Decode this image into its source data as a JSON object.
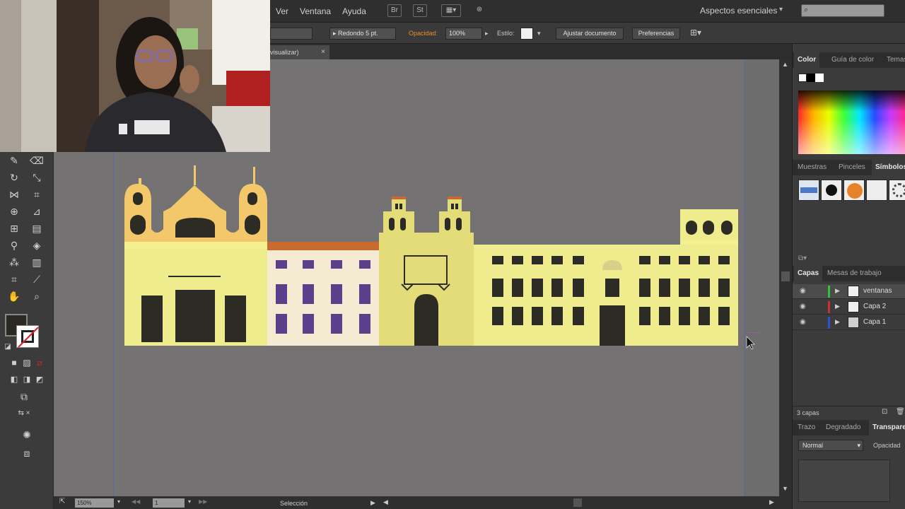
{
  "menu": {
    "items": [
      "Ver",
      "Ventana",
      "Ayuda"
    ],
    "workspace": "Aspectos esenciales"
  },
  "control_bar": {
    "brush": "Redondo 5 pt.",
    "opacity_label": "Opacidad:",
    "opacity_value": "100%",
    "style_label": "Estilo:",
    "doc_setup_button": "Ajustar documento",
    "prefs_button": "Preferencias"
  },
  "document": {
    "tab_label": "visualizar)",
    "close": "×"
  },
  "status": {
    "zoom": "150%",
    "page": "1",
    "tool": "Selección"
  },
  "panels": {
    "color_tabs": [
      "Color",
      "Guía de color",
      "Temas"
    ],
    "swatch_tabs": [
      "Muestras",
      "Pinceles",
      "Símbolos"
    ],
    "layer_tabs": [
      "Capas",
      "Mesas de trabajo"
    ],
    "layers": [
      {
        "name": "ventanas",
        "color": "#3bbf3b",
        "selected": true
      },
      {
        "name": "Capa 2",
        "color": "#d03030",
        "selected": false
      },
      {
        "name": "Capa 1",
        "color": "#3050d0",
        "selected": false
      }
    ],
    "layer_count": "3 capas",
    "appearance_tabs": [
      "Trazo",
      "Degradado",
      "Transparencia"
    ],
    "blend_mode": "Normal",
    "opacity_label": "Opacidad"
  },
  "colors": {
    "building_yellow": "#eeec8c",
    "dome_orange": "#f2c86a",
    "dark_window": "#2c2c24",
    "purple_window": "#5b3f8a"
  }
}
